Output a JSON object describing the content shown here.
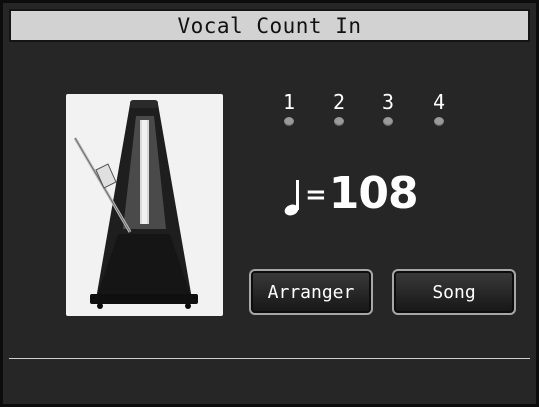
{
  "title": "Vocal Count In",
  "beats": [
    "1",
    "2",
    "3",
    "4"
  ],
  "tempo": {
    "icon": "quarter-note-icon",
    "equals": "=",
    "value": "108"
  },
  "buttons": {
    "arranger": "Arranger",
    "song": "Song"
  },
  "image": {
    "icon": "metronome-icon"
  },
  "colors": {
    "background": "#262626",
    "title_bar": "#d2d2d2",
    "led_off": "#9a9a9a"
  }
}
